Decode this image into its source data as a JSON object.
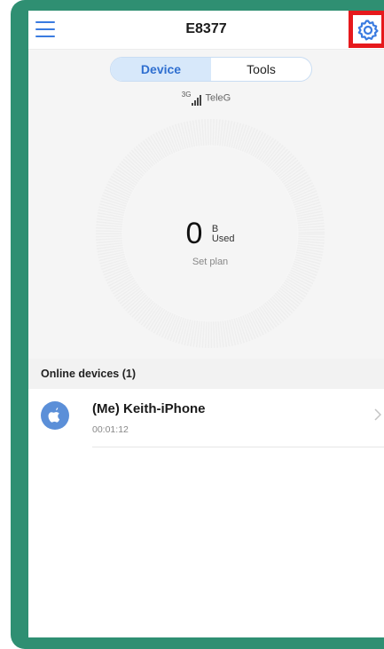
{
  "header": {
    "title": "E8377",
    "menu_icon": "hamburger-menu-icon",
    "settings_icon": "gear-icon"
  },
  "tabs": [
    {
      "label": "Device",
      "active": true
    },
    {
      "label": "Tools",
      "active": false
    }
  ],
  "status": {
    "network_type": "3G",
    "carrier": "TeleG",
    "signal_icon": "signal-bars-icon"
  },
  "usage": {
    "value": "0",
    "unit": "B",
    "unit_label": "Used",
    "set_plan_label": "Set plan"
  },
  "devices_section": {
    "title": "Online devices (1)",
    "devices": [
      {
        "name": "(Me) Keith-iPhone",
        "duration": "00:01:12",
        "icon": "apple-logo-icon"
      }
    ]
  },
  "colors": {
    "accent": "#3a7be0",
    "highlight": "#e6191c",
    "frame": "#2f8f72",
    "avatar": "#5b8fd8"
  }
}
